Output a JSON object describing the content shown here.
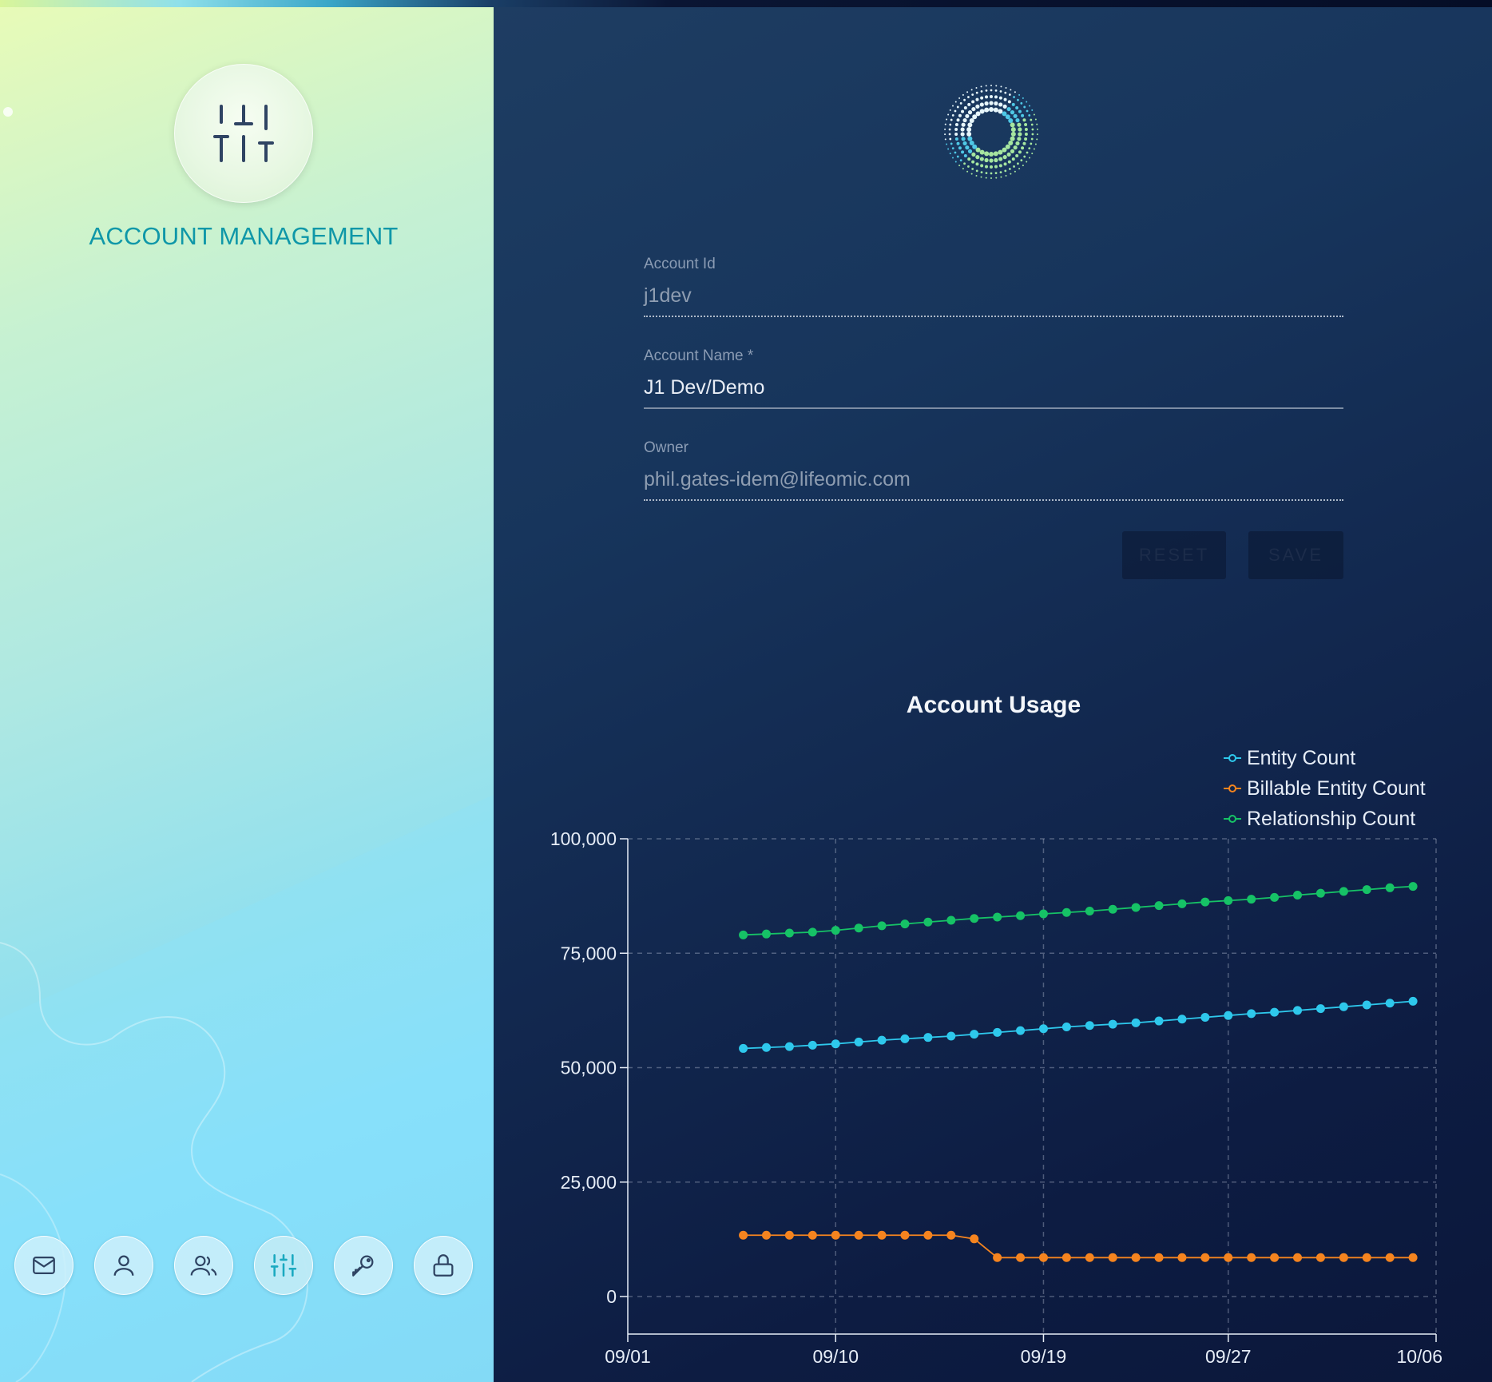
{
  "left_panel": {
    "title": "ACCOUNT MANAGEMENT",
    "hero_icon": "sliders-icon",
    "nav": [
      {
        "icon": "mail-icon",
        "active": false
      },
      {
        "icon": "user-icon",
        "active": false
      },
      {
        "icon": "users-icon",
        "active": false
      },
      {
        "icon": "sliders-icon",
        "active": true
      },
      {
        "icon": "key-icon",
        "active": false
      },
      {
        "icon": "lock-icon",
        "active": false
      }
    ]
  },
  "form": {
    "account_id": {
      "label": "Account Id",
      "value": "j1dev"
    },
    "account_name": {
      "label": "Account Name *",
      "value": "J1 Dev/Demo"
    },
    "owner": {
      "label": "Owner",
      "value": "phil.gates-idem@lifeomic.com"
    },
    "reset_label": "RESET",
    "save_label": "SAVE"
  },
  "colors": {
    "entity": "#2ec8ec",
    "billable": "#f5841f",
    "relationship": "#16c266",
    "accent": "#0f97a8"
  },
  "chart_data": {
    "type": "line",
    "title": "Account Usage",
    "xlabel": "",
    "ylabel": "",
    "x_ticks": [
      "09/01",
      "09/10",
      "09/19",
      "09/27",
      "10/06"
    ],
    "y_ticks": [
      "100,000",
      "75,000",
      "50,000",
      "25,000",
      "0"
    ],
    "ylim": [
      0,
      100000
    ],
    "grid": true,
    "legend_position": "top-right",
    "x": [
      "09/06",
      "09/07",
      "09/08",
      "09/09",
      "09/10",
      "09/11",
      "09/12",
      "09/13",
      "09/14",
      "09/15",
      "09/16",
      "09/17",
      "09/18",
      "09/19",
      "09/20",
      "09/21",
      "09/22",
      "09/23",
      "09/24",
      "09/25",
      "09/26",
      "09/27",
      "09/28",
      "09/29",
      "09/30",
      "10/01",
      "10/02",
      "10/03",
      "10/04",
      "10/05"
    ],
    "series": [
      {
        "name": "Entity Count",
        "values": [
          54200,
          54400,
          54600,
          54900,
          55200,
          55600,
          56000,
          56300,
          56600,
          56900,
          57300,
          57700,
          58100,
          58500,
          58900,
          59200,
          59500,
          59800,
          60200,
          60600,
          61000,
          61400,
          61800,
          62100,
          62500,
          62900,
          63300,
          63700,
          64100,
          64500
        ]
      },
      {
        "name": "Billable Entity Count",
        "values": [
          13400,
          13400,
          13400,
          13400,
          13400,
          13400,
          13400,
          13400,
          13400,
          13400,
          12600,
          8500,
          8500,
          8500,
          8500,
          8500,
          8500,
          8500,
          8500,
          8500,
          8500,
          8500,
          8500,
          8500,
          8500,
          8500,
          8500,
          8500,
          8500,
          8500
        ]
      },
      {
        "name": "Relationship Count",
        "values": [
          79000,
          79200,
          79400,
          79600,
          80000,
          80500,
          81000,
          81400,
          81800,
          82200,
          82600,
          82900,
          83200,
          83600,
          83900,
          84200,
          84600,
          85000,
          85400,
          85800,
          86200,
          86500,
          86800,
          87200,
          87700,
          88100,
          88500,
          88900,
          89300,
          89600
        ]
      }
    ]
  }
}
